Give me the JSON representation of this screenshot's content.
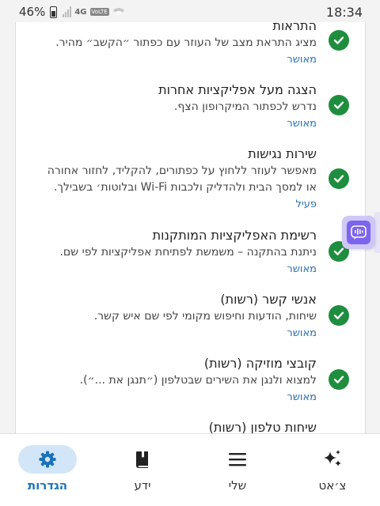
{
  "status_bar": {
    "battery": "46%",
    "network": "4G",
    "volte": "VoLTE",
    "time": "18:34"
  },
  "permissions": [
    {
      "title": "התראות",
      "description": "מציג התראת מצב של העוזר עם כפתור ״הקשב״ מהיר.",
      "status": "מאושר",
      "icon": "check-circle-icon"
    },
    {
      "title": "הצגה מעל אפליקציות אחרות",
      "description": "נדרש לכפתור המיקרופון הצף.",
      "status": "מאושר",
      "icon": "check-circle-icon"
    },
    {
      "title": "שירות נגישות",
      "description": "מאפשר לעוזר ללחוץ על כפתורים, להקליד, לחזור אחורה או למסך הבית ולהדליק ולכבות Wi-Fi ובלוטות׳ בשבילך.",
      "status": "פעיל",
      "icon": "check-circle-icon"
    },
    {
      "title": "רשימת האפליקציות המותקנות",
      "description": "ניתנת בהתקנה – משמשת לפתיחת אפליקציות לפי שם.",
      "status": "מאושר",
      "icon": "check-circle-icon"
    },
    {
      "title": "אנשי קשר (רשות)",
      "description": "שיחות, הודעות וחיפוש מקומי לפי שם איש קשר.",
      "status": "מאושר",
      "icon": "check-circle-icon"
    },
    {
      "title": "קובצי מוזיקה (רשות)",
      "description": "למצוא ולנגן את השירים שבטלפון (״תנגן את ...״).",
      "status": "מאושר",
      "icon": "check-circle-icon"
    },
    {
      "title": "שיחות טלפון (רשות)",
      "description": "",
      "status": "",
      "icon": "check-circle-icon"
    }
  ],
  "floating_button": {
    "icon": "voice-waveform-icon"
  },
  "bottom_nav": {
    "items": [
      {
        "label": "צ׳אט",
        "icon": "sparkle-icon",
        "active": false
      },
      {
        "label": "שלי",
        "icon": "menu-icon",
        "active": false
      },
      {
        "label": "ידע",
        "icon": "book-icon",
        "active": false
      },
      {
        "label": "הגדרות",
        "icon": "gear-icon",
        "active": true
      }
    ]
  },
  "colors": {
    "check": "#1e8e3e",
    "status_link": "#2a6fb5",
    "nav_active_bg": "#d3e6f7",
    "nav_active_text": "#1a73b8",
    "float_button": "#7c64ee"
  }
}
